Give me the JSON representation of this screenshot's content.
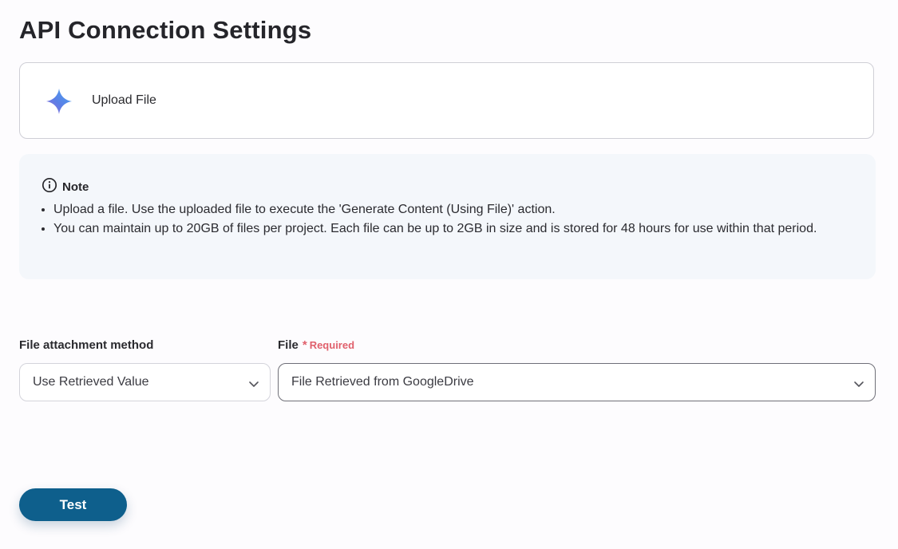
{
  "page": {
    "title": "API Connection Settings"
  },
  "action_card": {
    "icon": "gemini-sparkle-icon",
    "label": "Upload File"
  },
  "note": {
    "icon": "info-icon",
    "title": "Note",
    "items": [
      "Upload a file. Use the uploaded file to execute the 'Generate Content (Using File)' action.",
      "You can maintain up to 20GB of files per project. Each file can be up to 2GB in size and is stored for 48 hours for use within that period."
    ]
  },
  "form": {
    "attachment_method": {
      "label": "File attachment method",
      "value": "Use Retrieved Value"
    },
    "file": {
      "label": "File",
      "required_mark": "*",
      "required_text": "Required",
      "value": "File Retrieved from GoogleDrive"
    }
  },
  "actions": {
    "test_label": "Test"
  },
  "colors": {
    "primary": "#0e5f8c",
    "required": "#e0606c",
    "note_bg": "#f4f7fb"
  }
}
